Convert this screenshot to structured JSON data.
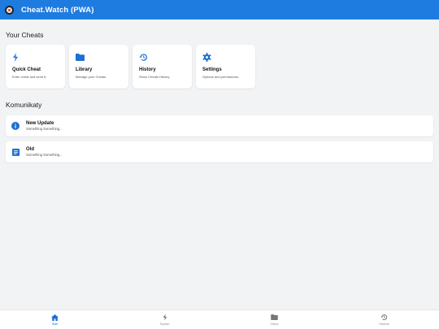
{
  "app": {
    "title": "Cheat.Watch (PWA)"
  },
  "sections": {
    "cheats_heading": "Your Cheats",
    "messages_heading": "Komunikaty"
  },
  "cards": [
    {
      "title": "Quick Cheat",
      "subtitle": "Enter cheat and send it.",
      "icon": "lightning-icon"
    },
    {
      "title": "Library",
      "subtitle": "Manage your Cheats.",
      "icon": "folder-icon"
    },
    {
      "title": "History",
      "subtitle": "Show Cheats History.",
      "icon": "history-icon"
    },
    {
      "title": "Settings",
      "subtitle": "Options and permissions.",
      "icon": "gear-icon"
    }
  ],
  "notifications": [
    {
      "title": "New Update",
      "subtitle": "Something Something...",
      "icon": "info-icon"
    },
    {
      "title": "Old",
      "subtitle": "Something Something...",
      "icon": "document-icon"
    }
  ],
  "bottom_nav": [
    {
      "label": "Start",
      "icon": "home-icon",
      "active": true
    },
    {
      "label": "Szybko",
      "icon": "lightning-icon",
      "active": false
    },
    {
      "label": "Zbiory",
      "icon": "folder-icon",
      "active": false
    },
    {
      "label": "Historia",
      "icon": "history-icon",
      "active": false
    }
  ],
  "colors": {
    "accent": "#1e7be0",
    "background": "#f2f3f5",
    "surface": "#ffffff"
  }
}
